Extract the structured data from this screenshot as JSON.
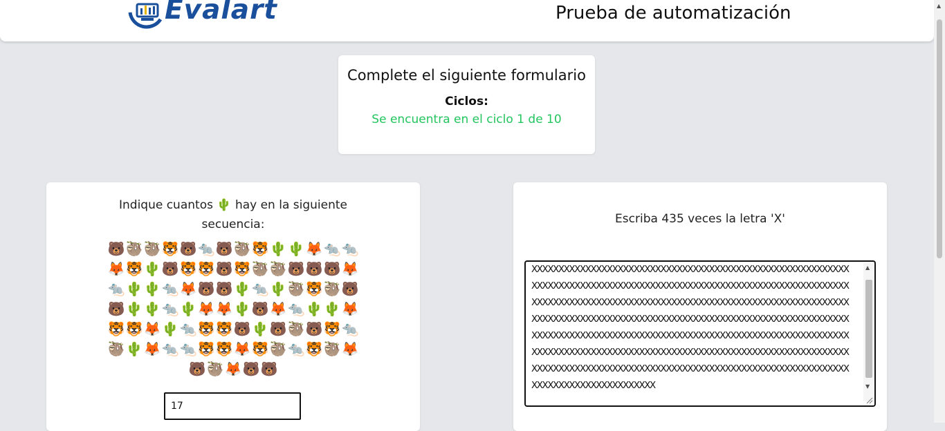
{
  "header": {
    "brand": "Evalart",
    "title": "Prueba de automatización"
  },
  "cycle": {
    "title": "Complete el siguiente formulario",
    "label": "Ciclos:",
    "status": "Se encuentra en el ciclo 1 de 10",
    "status_color": "#22c55e"
  },
  "question": {
    "prefix": "Indique cuantos",
    "icon": "🌵",
    "suffix": "hay en la siguiente secuencia:",
    "sequence": [
      "🐻",
      "🦥",
      "🦥",
      "🐯",
      "🐻",
      "🐀",
      "🐻",
      "🦥",
      "🐯",
      "🌵",
      "🌵",
      "🦊",
      "🐀",
      "🐀",
      "🦊",
      "🐯",
      "🌵",
      "🐻",
      "🐯",
      "🐯",
      "🐻",
      "🐯",
      "🦥",
      "🦥",
      "🐻",
      "🐻",
      "🐻",
      "🦊",
      "🐀",
      "🌵",
      "🌵",
      "🐀",
      "🦊",
      "🐻",
      "🐻",
      "🌵",
      "🐀",
      "🌵",
      "🦥",
      "🐯",
      "🦥",
      "🐻",
      "🐻",
      "🌵",
      "🌵",
      "🐀",
      "🌵",
      "🦊",
      "🦊",
      "🌵",
      "🐻",
      "🦊",
      "🐀",
      "🌵",
      "🌵",
      "🦊",
      "🐯",
      "🐯",
      "🦊",
      "🌵",
      "🐀",
      "🐯",
      "🐯",
      "🐻",
      "🌵",
      "🐻",
      "🦥",
      "🐻",
      "🐯",
      "🐀",
      "🦥",
      "🌵",
      "🦊",
      "🐀",
      "🐀",
      "🐯",
      "🐯",
      "🦊",
      "🐯",
      "🦥",
      "🐀",
      "🐯",
      "🦥",
      "🦊",
      "🐻",
      "🦥",
      "🦊",
      "🐻",
      "🐻"
    ],
    "answer_value": "17"
  },
  "textarea": {
    "instruction": "Escriba 435 veces la letra 'X'",
    "value": "XXXXXXXXXXXXXXXXXXXXXXXXXXXXXXXXXXXXXXXXXXXXXXXXXXXXXXXXXXXXXXXXXXXXXXXXXXXXXXXXXXXXXXXXXXXXXXXXXXXXXXXXXXXXXXXXXXXXXXXXXXXXXXXXXXXXXXXXXXXXXXXXXXXXXXXXXXXXXXXXXXXXXXXXXXXXXXXXXXXXXXXXXXXXXXXXXXXXXXXXXXXXXXXXXXXXXXXXXXXXXXXXXXXXXXXXXXXXXXXXXXXXXXXXXXXXXXXXXXXXXXXXXXXXXXXXXXXXXXXXXXXXXXXXXXXXXXXXXXXXXXXXXXXXXXXXXXXXXXXXXXXXXXXXXXXXXXXXXXXXXXXXXXXXXXXXXXXXXXXXXXXXXXXXXXXXXXXXXXXXXXXXXXXXXXXXXXXXXXXXXXXXXXXXXXXXXXXXXXXXXXXXXXXXXXXXXXXX"
  }
}
